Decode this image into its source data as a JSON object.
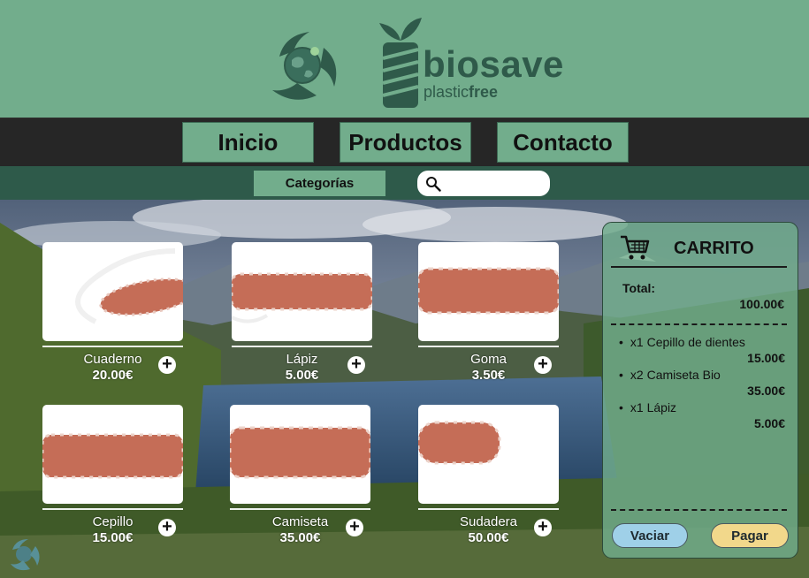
{
  "header": {
    "brand_name": "biosave",
    "brand_tagline_plastic": "plastic",
    "brand_tagline_free": "free"
  },
  "nav": {
    "items": [
      {
        "label": "Inicio"
      },
      {
        "label": "Productos"
      },
      {
        "label": "Contacto"
      }
    ]
  },
  "subnav": {
    "categories_label": "Categorías",
    "search_value": ""
  },
  "products": [
    {
      "name": "Cuaderno",
      "price": "20.00€"
    },
    {
      "name": "Lápiz",
      "price": "5.00€"
    },
    {
      "name": "Goma",
      "price": "3.50€"
    },
    {
      "name": "Cepillo",
      "price": "15.00€"
    },
    {
      "name": "Camiseta",
      "price": "35.00€"
    },
    {
      "name": "Sudadera",
      "price": "50.00€"
    }
  ],
  "add_symbol": "+",
  "cart": {
    "title": "CARRITO",
    "total_label": "Total:",
    "total_value": "100.00€",
    "items": [
      {
        "qty_name": "x1  Cepillo de dientes",
        "price": "15.00€"
      },
      {
        "qty_name": "x2 Camiseta Bio",
        "price": "35.00€"
      },
      {
        "qty_name": "x1 Lápiz",
        "price": "5.00€"
      }
    ],
    "empty_label": "Vaciar",
    "pay_label": "Pagar"
  },
  "colors": {
    "header_bg": "#72ad8c",
    "nav_bg": "#262626",
    "subnav_bg": "#2e5a4a",
    "brand": "#2f5a4a",
    "empty_button": "#9fd0e8",
    "pay_button": "#f2d88b"
  },
  "icons": {
    "logo": "recycle-globe-icon",
    "brand": "plant-bottle-icon",
    "search": "search-icon",
    "cart": "shopping-cart-icon",
    "add": "plus-circle-icon"
  }
}
